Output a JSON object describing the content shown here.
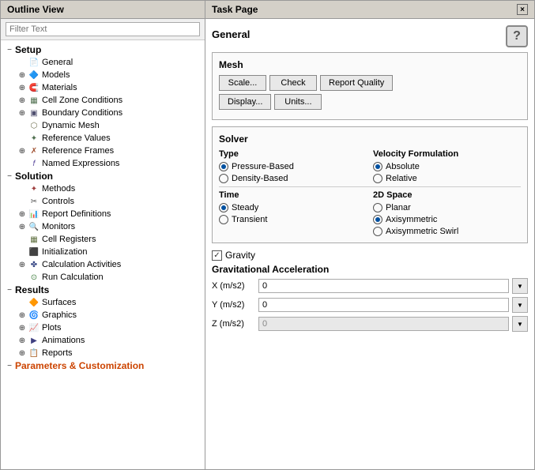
{
  "outline_panel": {
    "title": "Outline View",
    "filter_placeholder": "Filter Text",
    "tree": {
      "setup": {
        "label": "Setup",
        "items": [
          {
            "label": "General",
            "icon": "page",
            "indent": 1,
            "expandable": false
          },
          {
            "label": "Models",
            "icon": "models",
            "indent": 1,
            "expandable": true
          },
          {
            "label": "Materials",
            "icon": "materials",
            "indent": 1,
            "expandable": true
          },
          {
            "label": "Cell Zone Conditions",
            "icon": "cell-zone",
            "indent": 1,
            "expandable": true
          },
          {
            "label": "Boundary Conditions",
            "icon": "boundary",
            "indent": 1,
            "expandable": true
          },
          {
            "label": "Dynamic Mesh",
            "icon": "dynamic",
            "indent": 1,
            "expandable": false
          },
          {
            "label": "Reference Values",
            "icon": "reference",
            "indent": 1,
            "expandable": false
          },
          {
            "label": "Reference Frames",
            "icon": "frames",
            "indent": 1,
            "expandable": true
          },
          {
            "label": "Named Expressions",
            "icon": "named",
            "indent": 1,
            "expandable": false
          }
        ]
      },
      "solution": {
        "label": "Solution",
        "items": [
          {
            "label": "Methods",
            "icon": "methods",
            "indent": 1,
            "expandable": false
          },
          {
            "label": "Controls",
            "icon": "controls",
            "indent": 1,
            "expandable": false
          },
          {
            "label": "Report Definitions",
            "icon": "report-def",
            "indent": 1,
            "expandable": true
          },
          {
            "label": "Monitors",
            "icon": "monitors",
            "indent": 1,
            "expandable": true
          },
          {
            "label": "Cell Registers",
            "icon": "registers",
            "indent": 1,
            "expandable": false
          },
          {
            "label": "Initialization",
            "icon": "init",
            "indent": 1,
            "expandable": false
          },
          {
            "label": "Calculation Activities",
            "icon": "calc",
            "indent": 1,
            "expandable": true
          },
          {
            "label": "Run Calculation",
            "icon": "run",
            "indent": 1,
            "expandable": false
          }
        ]
      },
      "results": {
        "label": "Results",
        "items": [
          {
            "label": "Surfaces",
            "icon": "surfaces",
            "indent": 1,
            "expandable": false
          },
          {
            "label": "Graphics",
            "icon": "graphics",
            "indent": 1,
            "expandable": true
          },
          {
            "label": "Plots",
            "icon": "plots",
            "indent": 1,
            "expandable": true
          },
          {
            "label": "Animations",
            "icon": "anim",
            "indent": 1,
            "expandable": true
          },
          {
            "label": "Reports",
            "icon": "reports",
            "indent": 1,
            "expandable": true
          }
        ]
      },
      "params": {
        "label": "Parameters & Customization"
      }
    }
  },
  "task_panel": {
    "title": "Task Page",
    "close_icon": "×",
    "page_title": "General",
    "help_symbol": "?",
    "mesh": {
      "title": "Mesh",
      "buttons": {
        "scale": "Scale...",
        "check": "Check",
        "report_quality": "Report Quality",
        "display": "Display...",
        "units": "Units..."
      }
    },
    "solver": {
      "title": "Solver",
      "type_title": "Type",
      "types": [
        {
          "label": "Pressure-Based",
          "selected": true
        },
        {
          "label": "Density-Based",
          "selected": false
        }
      ],
      "velocity_title": "Velocity Formulation",
      "velocities": [
        {
          "label": "Absolute",
          "selected": true
        },
        {
          "label": "Relative",
          "selected": false
        }
      ]
    },
    "time": {
      "title": "Time",
      "options": [
        {
          "label": "Steady",
          "selected": true
        },
        {
          "label": "Transient",
          "selected": false
        }
      ]
    },
    "space_2d": {
      "title": "2D Space",
      "options": [
        {
          "label": "Planar",
          "selected": false
        },
        {
          "label": "Axisymmetric",
          "selected": true
        },
        {
          "label": "Axisymmetric Swirl",
          "selected": false
        }
      ]
    },
    "gravity": {
      "label": "Gravity",
      "checked": true,
      "accel_title": "Gravitational Acceleration",
      "fields": [
        {
          "label": "X (m/s2)",
          "value": "0",
          "enabled": true
        },
        {
          "label": "Y (m/s2)",
          "value": "0",
          "enabled": true
        },
        {
          "label": "Z (m/s2)",
          "value": "0",
          "enabled": false
        }
      ]
    }
  }
}
